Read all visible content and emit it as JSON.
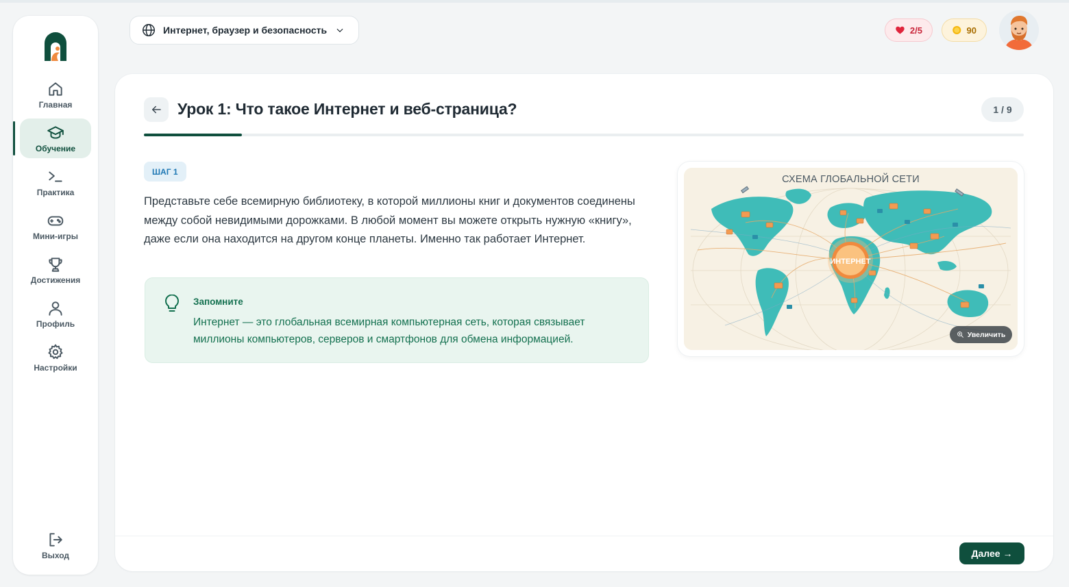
{
  "sidebar": {
    "items": [
      {
        "label": "Главная",
        "icon": "home-icon"
      },
      {
        "label": "Обучение",
        "icon": "graduation-cap-icon",
        "active": true
      },
      {
        "label": "Практика",
        "icon": "terminal-icon"
      },
      {
        "label": "Мини-игры",
        "icon": "gamepad-icon"
      },
      {
        "label": "Достижения",
        "icon": "trophy-icon"
      },
      {
        "label": "Профиль",
        "icon": "user-icon"
      },
      {
        "label": "Настройки",
        "icon": "gear-icon"
      }
    ],
    "logout_label": "Выход"
  },
  "header": {
    "course": "Интернет, браузер и безопасность",
    "lives": "2/5",
    "coins": "90"
  },
  "lesson": {
    "title": "Урок 1: Что такое Интернет и веб-страница?",
    "step_counter": "1 / 9",
    "progress": 0.111,
    "step_badge": "ШАГ 1",
    "text": "Представьте себе всемирную библиотеку, в которой миллионы книг и документов соединены между собой невидимыми дорожками. В любой момент вы можете открыть нужную «книгу», даже если она находится на другом конце планеты. Именно так работает Интернет.",
    "note_title": "Запомните",
    "note_text": "Интернет — это глобальная всемирная компьютерная сеть, которая связывает миллионы компьютеров, серверов и смартфонов для обмена информацией.",
    "image_title": "СХЕМА ГЛОБАЛЬНОЙ СЕТИ",
    "image_center_label": "ИНТЕРНЕТ",
    "zoom_label": "Увеличить",
    "next_label": "Далее →"
  },
  "colors": {
    "brand": "#0f4f3d",
    "note_bg": "#e9f5ef",
    "badge_bg": "#e3f0f8",
    "heart": "#e0243c",
    "coin": "#f5b70f",
    "map_land": "#3fbcb8",
    "map_hub": "#f08a3e"
  }
}
